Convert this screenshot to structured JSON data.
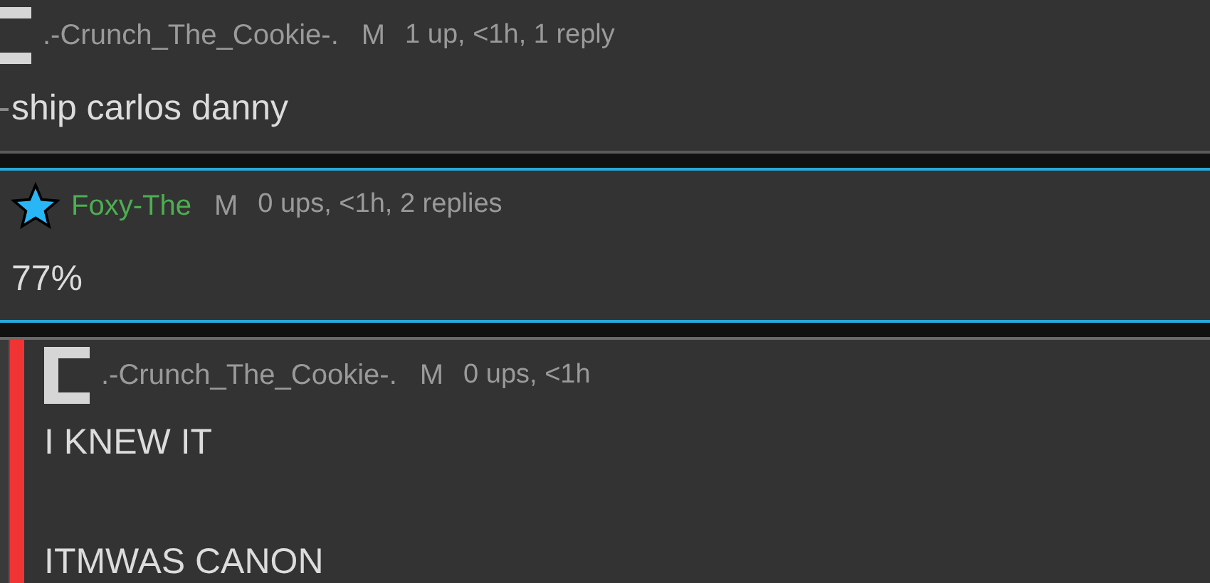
{
  "comments": [
    {
      "kind": "pixel-c",
      "username": ".-Crunch_The_Cookie-.",
      "color": "#9a9a9a",
      "gender": "M",
      "meta": "1 up, <1h, 1 reply",
      "lines": [
        "ship carlos danny"
      ],
      "highlighted": false,
      "marked": false,
      "cut_left": true
    },
    {
      "kind": "star",
      "username": "Foxy-The",
      "color": "#4caf50",
      "gender": "M",
      "meta": "0 ups, <1h, 2 replies",
      "lines": [
        "77%"
      ],
      "highlighted": true,
      "marked": false,
      "cut_left": false
    },
    {
      "kind": "pixel-c",
      "username": ".-Crunch_The_Cookie-.",
      "color": "#9a9a9a",
      "gender": "M",
      "meta": "0 ups, <1h",
      "lines": [
        "I KNEW IT",
        "ITMWAS CANON"
      ],
      "highlighted": false,
      "marked": true,
      "cut_left": false
    }
  ]
}
